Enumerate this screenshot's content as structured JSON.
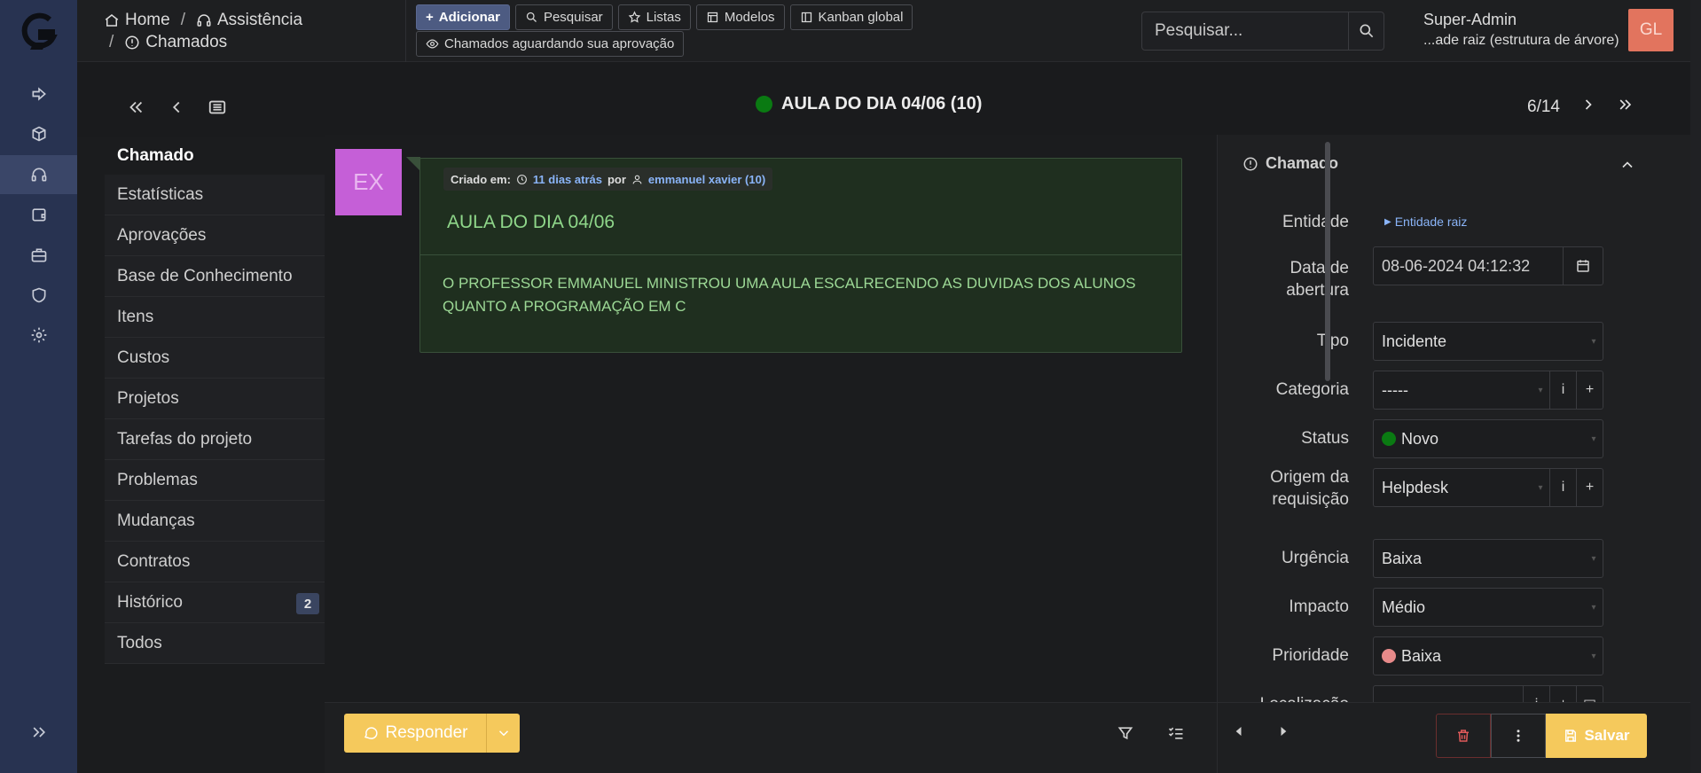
{
  "header": {
    "breadcrumb": [
      "Home",
      "Assistência",
      "Chamados"
    ],
    "buttons": [
      "Adicionar",
      "Pesquisar",
      "Listas",
      "Modelos",
      "Kanban global"
    ],
    "approval_button": "Chamados aguardando sua aprovação",
    "search_placeholder": "Pesquisar...",
    "user_name": "Super-Admin",
    "user_entity": "...ade raiz (estrutura de árvore)",
    "avatar_initials": "GL"
  },
  "item": {
    "title": "AULA DO DIA 04/06 (10)",
    "position": "6/14",
    "status_color": "#0a7a12"
  },
  "tabs": [
    {
      "label": "Chamado"
    },
    {
      "label": "Estatísticas"
    },
    {
      "label": "Aprovações"
    },
    {
      "label": "Base de Conhecimento"
    },
    {
      "label": "Itens"
    },
    {
      "label": "Custos"
    },
    {
      "label": "Projetos"
    },
    {
      "label": "Tarefas do projeto"
    },
    {
      "label": "Problemas"
    },
    {
      "label": "Mudanças"
    },
    {
      "label": "Contratos"
    },
    {
      "label": "Histórico",
      "badge": "2"
    },
    {
      "label": "Todos"
    }
  ],
  "timeline": {
    "avatar": "EX",
    "created_label": "Criado em:",
    "created_when": "11 dias atrás",
    "by_label": "por",
    "author": "emmanuel xavier (10)",
    "title": "AULA DO DIA 04/06",
    "content": "O PROFESSOR EMMANUEL MINISTROU UMA AULA ESCALRECENDO AS DUVIDAS DOS ALUNOS QUANTO A PROGRAMAÇÃO EM C"
  },
  "details": {
    "heading": "Chamado",
    "entidade_label": "Entidade",
    "entidade_value": "Entidade raiz",
    "data_label_1": "Data de",
    "data_label_2": "abertura",
    "data_value": "08-06-2024 04:12:32",
    "tipo_label": "Tipo",
    "tipo_value": "Incidente",
    "categoria_label": "Categoria",
    "categoria_value": "-----",
    "status_label": "Status",
    "status_value": "Novo",
    "origem_label_1": "Origem da",
    "origem_label_2": "requisição",
    "origem_value": "Helpdesk",
    "urgencia_label": "Urgência",
    "urgencia_value": "Baixa",
    "impacto_label": "Impacto",
    "impacto_value": "Médio",
    "prioridade_label": "Prioridade",
    "prioridade_value": "Baixa",
    "prioridade_color": "#e78a8a",
    "localizacao_label": "Localização"
  },
  "actions": {
    "respond": "Responder",
    "save": "Salvar"
  }
}
